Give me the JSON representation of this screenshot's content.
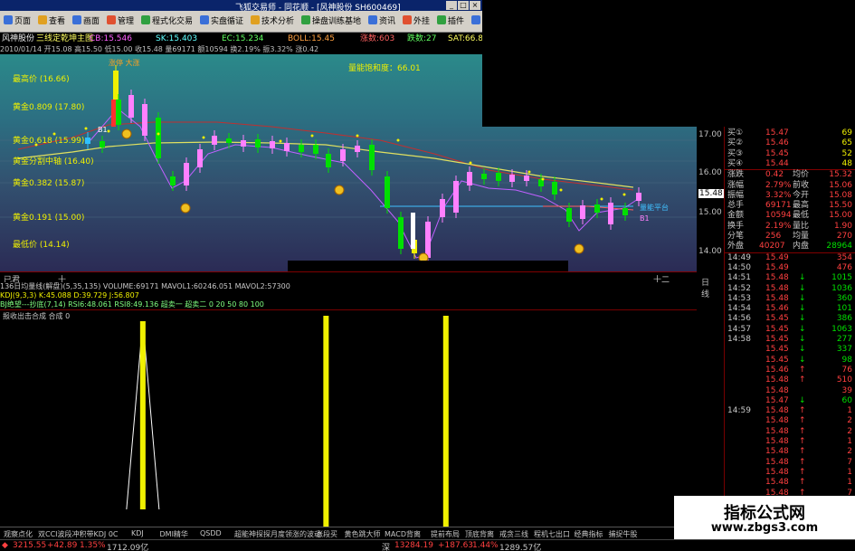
{
  "window": {
    "title": "飞狐交易师 - 同花顺 - [风神股份 SH600469]"
  },
  "toolbar": [
    {
      "label": "页面",
      "color": "#3a6fd8"
    },
    {
      "label": "查看",
      "color": "#e0a020"
    },
    {
      "label": "画面",
      "color": "#3a6fd8"
    },
    {
      "label": "管理",
      "color": "#e05030"
    },
    {
      "label": "程式化交易",
      "color": "#30a040"
    },
    {
      "label": "实盘循证",
      "color": "#3a6fd8"
    },
    {
      "label": "技术分析",
      "color": "#e0a020"
    },
    {
      "label": "操盘训练基地",
      "color": "#30a040"
    },
    {
      "label": "资讯",
      "color": "#3a6fd8"
    },
    {
      "label": "外挂",
      "color": "#e05030"
    },
    {
      "label": "插件",
      "color": "#30a040"
    },
    {
      "label": "窗口",
      "color": "#3a6fd8"
    },
    {
      "label": "帮助",
      "color": "#e0a020"
    }
  ],
  "tabs": [
    "风神股份",
    "三线定乾坤主图",
    "CB:15.546",
    "SK:15.403",
    "EC:15.234",
    "BOLL:15.45",
    "涨数:603",
    "跌数:27",
    "SAT:66.810"
  ],
  "info_line": "2010/01/14 开15.08 高15.50 低15.00 收15.48 量69171 额10594 换2.19% 振3.32% 涨0.42",
  "price_levels": [
    {
      "label": "最高价 (16.66)"
    },
    {
      "label": "黄金0.809 (17.80)"
    },
    {
      "label": "黄金0.618 (15.99)"
    },
    {
      "label": "黄金分割中轴 (16.40)"
    },
    {
      "label": "黄金0.382 (15.87)"
    },
    {
      "label": "黄金0.191 (15.00)"
    },
    {
      "label": "最低价 (14.14)"
    }
  ],
  "chart_labels": {
    "top_badge": "涨停 大涨",
    "satisfaction": "量能饱和度：66.01",
    "buy_tag": "B1",
    "sell_tag_right": "量能平台",
    "sell_tag_right2": "B1"
  },
  "right_axis": [
    "17.00",
    "16.00",
    "15.48",
    "15.00",
    "14.00"
  ],
  "right_axis_highlight": "15.48",
  "date_axis": [
    "已君",
    "十",
    "十二",
    "日线"
  ],
  "volume_lines": [
    "136日均量线(解盘)(5,35,135) VOLUME:69171 MAVOL1:60246.051 MAVOL2:57300",
    "KDJ(9,3,3) K:45.088 D:39.729 J:56.807",
    "BJ绝望---抄底(7,14) RSI6:48.061 RSI8:49.136 超卖一 超卖二 0 20 50 80 100"
  ],
  "indicator": {
    "title": "报收出击合成 合成 0",
    "spikes": [
      {
        "pos": 0.205,
        "type": "triangle"
      },
      {
        "pos": 0.468,
        "type": "bar"
      },
      {
        "pos": 0.64,
        "type": "bar"
      }
    ]
  },
  "bottom_tabs": [
    "观察点化",
    "双CCI波段冲积带KDJ 0C",
    "KDJ",
    "DMI精华",
    "QSDD",
    "超能神探探月度领涨的波动",
    "涨段买",
    "黄色跳大师",
    "MACD背离",
    "提前布局",
    "顶底背离",
    "戒贪三线",
    "程机七出口",
    "经典指标",
    "捕捉牛股"
  ],
  "status": {
    "sh_index": "3215.55",
    "sh_change": "+42.89",
    "sh_pct": "1.35%",
    "sh_amount": "1712.09亿",
    "sz_label": "深",
    "sz_index": "13284.19",
    "sz_change": "+187.63",
    "sz_pct": "1.44%",
    "sz_amount": "1289.57亿"
  },
  "quote": {
    "buy_orders": [
      {
        "label": "买①",
        "price": "15.47",
        "vol": "69"
      },
      {
        "label": "买②",
        "price": "15.46",
        "vol": "65"
      },
      {
        "label": "买③",
        "price": "15.45",
        "vol": "52"
      },
      {
        "label": "买④",
        "price": "15.44",
        "vol": "48"
      }
    ],
    "stats": [
      {
        "l1": "涨跌",
        "v1": "0.42",
        "l2": "均价",
        "v2": "15.32"
      },
      {
        "l1": "涨幅",
        "v1": "2.79%",
        "l2": "前收",
        "v2": "15.06"
      },
      {
        "l1": "振幅",
        "v1": "3.32%",
        "l2": "今开",
        "v2": "15.08"
      },
      {
        "l1": "总手",
        "v1": "69171",
        "l2": "最高",
        "v2": "15.50"
      },
      {
        "l1": "金额",
        "v1": "10594",
        "l2": "最低",
        "v2": "15.00"
      },
      {
        "l1": "换手",
        "v1": "2.19%",
        "l2": "量比",
        "v2": "1.90"
      },
      {
        "l1": "分笔",
        "v1": "256",
        "l2": "均量",
        "v2": "270"
      }
    ],
    "outer": {
      "l1": "外盘",
      "v1": "40207",
      "l2": "内盘",
      "v2": "28964"
    },
    "ticks": [
      {
        "time": "14:49",
        "price": "15.49",
        "dir": "",
        "vol": "354",
        "c": "up"
      },
      {
        "time": "14:50",
        "price": "15.49",
        "dir": "",
        "vol": "476",
        "c": "up"
      },
      {
        "time": "14:51",
        "price": "15.48",
        "dir": "↓",
        "vol": "1015",
        "c": "dn"
      },
      {
        "time": "14:52",
        "price": "15.48",
        "dir": "↓",
        "vol": "1036",
        "c": "dn"
      },
      {
        "time": "14:53",
        "price": "15.48",
        "dir": "↓",
        "vol": "360",
        "c": "dn"
      },
      {
        "time": "14:54",
        "price": "15.46",
        "dir": "↓",
        "vol": "101",
        "c": "dn"
      },
      {
        "time": "14:56",
        "price": "15.45",
        "dir": "↓",
        "vol": "386",
        "c": "dn"
      },
      {
        "time": "14:57",
        "price": "15.45",
        "dir": "↓",
        "vol": "1063",
        "c": "dn"
      },
      {
        "time": "14:58",
        "price": "15.45",
        "dir": "↓",
        "vol": "277",
        "c": "dn"
      },
      {
        "time": "",
        "price": "15.45",
        "dir": "↓",
        "vol": "337",
        "c": "dn"
      },
      {
        "time": "",
        "price": "15.45",
        "dir": "↓",
        "vol": "98",
        "c": "dn"
      },
      {
        "time": "",
        "price": "15.46",
        "dir": "↑",
        "vol": "76",
        "c": "up"
      },
      {
        "time": "",
        "price": "15.48",
        "dir": "↑",
        "vol": "510",
        "c": "up"
      },
      {
        "time": "",
        "price": "15.48",
        "dir": "",
        "vol": "39",
        "c": "up"
      },
      {
        "time": "",
        "price": "15.47",
        "dir": "↓",
        "vol": "60",
        "c": "dn"
      },
      {
        "time": "14:59",
        "price": "15.48",
        "dir": "↑",
        "vol": "1",
        "c": "up"
      },
      {
        "time": "",
        "price": "15.48",
        "dir": "↑",
        "vol": "2",
        "c": "up"
      },
      {
        "time": "",
        "price": "15.48",
        "dir": "↑",
        "vol": "2",
        "c": "up"
      },
      {
        "time": "",
        "price": "15.48",
        "dir": "↑",
        "vol": "1",
        "c": "up"
      },
      {
        "time": "",
        "price": "15.48",
        "dir": "↑",
        "vol": "2",
        "c": "up"
      },
      {
        "time": "",
        "price": "15.48",
        "dir": "↑",
        "vol": "7",
        "c": "up"
      },
      {
        "time": "",
        "price": "15.48",
        "dir": "↑",
        "vol": "1",
        "c": "up"
      },
      {
        "time": "",
        "price": "15.48",
        "dir": "↑",
        "vol": "1",
        "c": "up"
      },
      {
        "time": "",
        "price": "15.48",
        "dir": "↑",
        "vol": "7",
        "c": "up"
      },
      {
        "time": "",
        "price": "15.48",
        "dir": "↑",
        "vol": "2",
        "c": "up"
      },
      {
        "time": "",
        "price": "15.48",
        "dir": "↑",
        "vol": "4",
        "c": "up"
      },
      {
        "time": "",
        "price": "15.48",
        "dir": "↑",
        "vol": "3",
        "c": "up"
      },
      {
        "time": "",
        "price": "15.48",
        "dir": "↑",
        "vol": "1",
        "c": "up"
      },
      {
        "time": "",
        "price": "15.48",
        "dir": "↑",
        "vol": "2",
        "c": "up"
      },
      {
        "time": "",
        "price": "15.48",
        "dir": "↑",
        "vol": "1",
        "c": "up"
      }
    ]
  },
  "watermark": {
    "line1": "指标公式网",
    "line2": "www.zbgs3.com"
  },
  "colors": {
    "up": "#ff4040",
    "down": "#00e000",
    "gold": "#f0f000",
    "pink": "#ff80ff"
  }
}
